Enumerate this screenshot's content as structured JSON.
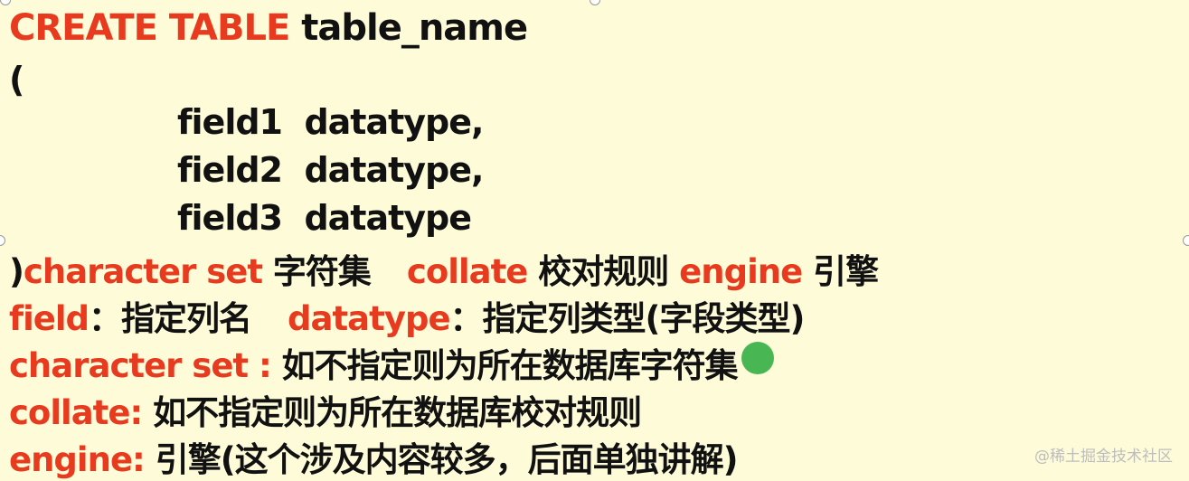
{
  "syntax": {
    "l1": {
      "keyword": "CREATE TABLE",
      "rest": " table_name"
    },
    "l2": {
      "text": "("
    },
    "fields": [
      "field1  datatype,",
      "field2  datatype,",
      "field3  datatype"
    ],
    "l6": {
      "paren": ")",
      "charset_kw": "character set",
      "charset_desc": " 字符集",
      "collate_kw": "collate",
      "collate_desc": " 校对规则 ",
      "engine_kw": "engine",
      "engine_desc": " 引擎"
    }
  },
  "notes": {
    "field": {
      "kw": "field",
      "desc": "：指定列名"
    },
    "datatype": {
      "kw": "datatype",
      "desc": "：指定列类型(字段类型)"
    },
    "charset": {
      "kw": "character set : ",
      "desc": "如不指定则为所在数据库字符集"
    },
    "collate": {
      "kw": "collate: ",
      "desc": "如不指定则为所在数据库校对规则"
    },
    "engine": {
      "kw": "engine: ",
      "desc": "引擎(这个涉及内容较多，后面单独讲解)"
    }
  },
  "watermark": "@稀土掘金技术社区",
  "colors": {
    "keyword": "#e83a1e",
    "text": "#111111",
    "background": "#fefbd8",
    "cursor": "#28aa3c"
  }
}
